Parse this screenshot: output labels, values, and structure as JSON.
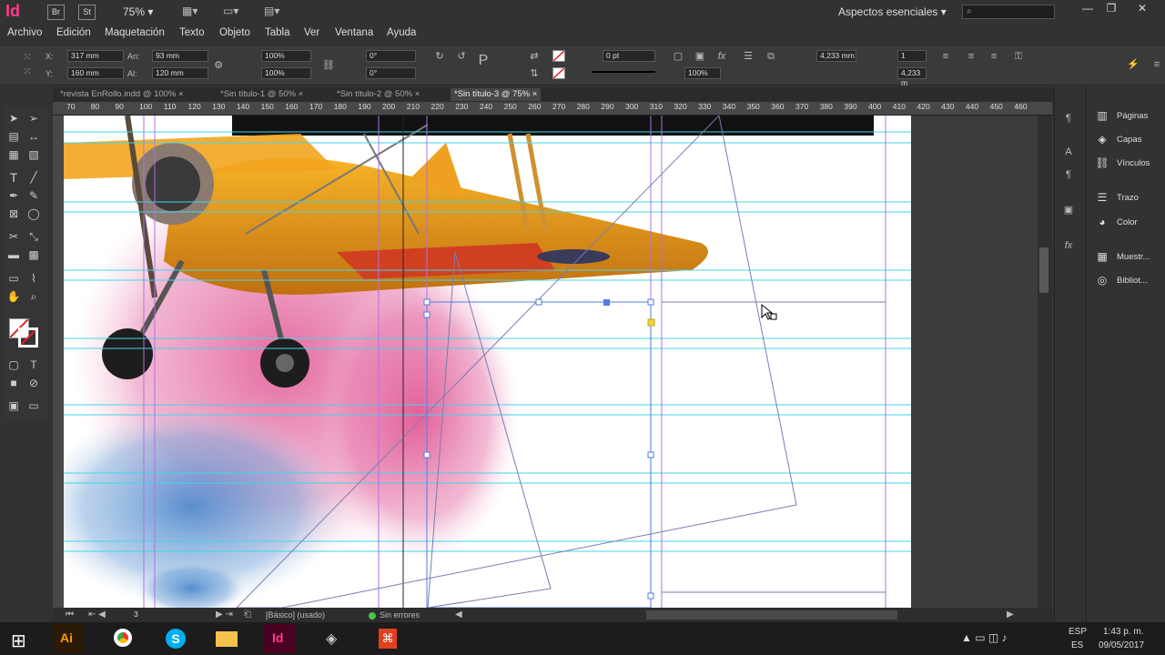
{
  "app": {
    "logo": "Id",
    "bridge_btn": "Br",
    "stock_btn": "St",
    "zoom": "75%",
    "workspace": "Aspectos esenciales",
    "search_placeholder": ""
  },
  "menu": [
    "Archivo",
    "Edición",
    "Maquetación",
    "Texto",
    "Objeto",
    "Tabla",
    "Ver",
    "Ventana",
    "Ayuda"
  ],
  "control": {
    "x_label": "X:",
    "x_value": "317 mm",
    "y_label": "Y:",
    "y_value": "160 mm",
    "w_label": "An:",
    "w_value": "93 mm",
    "h_label": "Al:",
    "h_value": "120 mm",
    "scale_x": "100%",
    "scale_y": "100%",
    "rotate": "0°",
    "shear": "0°",
    "stroke_weight": "0 pt",
    "gap": "4,233 mm",
    "gap2": "4,233 m",
    "cols": "1",
    "opacity": "100%"
  },
  "tabs": [
    {
      "label": "*revista EnRollo.indd @ 100%",
      "active": false
    },
    {
      "label": "*Sin título-1 @ 50%",
      "active": false
    },
    {
      "label": "*Sin título-2 @ 50%",
      "active": false
    },
    {
      "label": "*Sin título-3 @ 75%",
      "active": true
    }
  ],
  "ruler_ticks": [
    "70",
    "80",
    "90",
    "100",
    "110",
    "120",
    "130",
    "140",
    "150",
    "160",
    "170",
    "180",
    "190",
    "200",
    "210",
    "220",
    "230",
    "240",
    "250",
    "260",
    "270",
    "280",
    "290",
    "300",
    "310",
    "320",
    "330",
    "340",
    "350",
    "360",
    "370",
    "380",
    "390",
    "400",
    "410",
    "420",
    "430",
    "440",
    "450",
    "460"
  ],
  "panels": [
    {
      "label": "Páginas",
      "icon": "pages-icon"
    },
    {
      "label": "Capas",
      "icon": "layers-icon"
    },
    {
      "label": "Vínculos",
      "icon": "links-icon"
    },
    {
      "label": "Trazo",
      "icon": "stroke-icon"
    },
    {
      "label": "Color",
      "icon": "color-icon"
    },
    {
      "label": "Muestr...",
      "icon": "swatches-icon"
    },
    {
      "label": "Bibliot...",
      "icon": "libraries-icon"
    }
  ],
  "status": {
    "page": "3",
    "style": "[Básico] (usado)",
    "errors": "Sin errores"
  },
  "taskbar": {
    "lang": "ESP",
    "lang2": "ES",
    "time": "1:43 p. m.",
    "date": "09/05/2017"
  },
  "colors": {
    "guide_cyan": "#43d5e8",
    "guide_magenta": "#b070e0",
    "indesign_pink": "#ff3b8d"
  }
}
